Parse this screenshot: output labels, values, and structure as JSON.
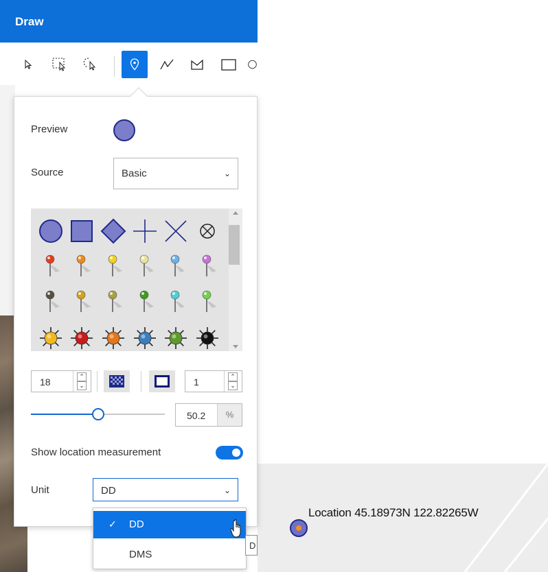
{
  "header": {
    "title": "Draw"
  },
  "toolbar": {
    "tools": [
      {
        "name": "select-tool",
        "label": "Select"
      },
      {
        "name": "rectangle-select-tool",
        "label": "Rectangle select"
      },
      {
        "name": "lasso-select-tool",
        "label": "Lasso select"
      },
      {
        "name": "point-tool",
        "label": "Point",
        "active": true
      },
      {
        "name": "polyline-tool",
        "label": "Polyline"
      },
      {
        "name": "polygon-tool",
        "label": "Polygon"
      },
      {
        "name": "rectangle-tool",
        "label": "Rectangle"
      },
      {
        "name": "circle-tool",
        "label": "Circle"
      }
    ]
  },
  "symbol_panel": {
    "preview_label": "Preview",
    "source_label": "Source",
    "source_value": "Basic",
    "gallery": {
      "rows": [
        [
          "circle",
          "square",
          "diamond",
          "cross",
          "x",
          "circle-x"
        ],
        [
          "pin-red",
          "pin-orange",
          "pin-yellow",
          "pin-light-yellow",
          "pin-light-blue",
          "pin-purple"
        ],
        [
          "pin-dark",
          "pin-gold",
          "pin-olive",
          "pin-green",
          "pin-cyan",
          "pin-light-green"
        ],
        [
          "star-yellow",
          "star-red",
          "star-orange",
          "star-blue",
          "star-green",
          "star-black"
        ]
      ],
      "colors": {
        "basic_fill": "#7c7ec9",
        "basic_stroke": "#1f2a8a",
        "pins": [
          "#e53c1c",
          "#f08a1c",
          "#f2d21e",
          "#e8e3a0",
          "#6fb1e6",
          "#c572d8",
          "#565040",
          "#d6a11a",
          "#a7a13d",
          "#3f9a1d",
          "#4cd0d6",
          "#72d24a"
        ],
        "stars": [
          "#f2b81c",
          "#c91b1b",
          "#e6761c",
          "#3a7fbd",
          "#5f9a2c",
          "#111111"
        ]
      }
    },
    "size_value": "18",
    "outline_width_value": "1",
    "opacity_value": "50.2",
    "opacity_unit": "%",
    "opacity_fraction": 0.502,
    "show_measurement_label": "Show location measurement",
    "show_measurement_on": true,
    "unit_label": "Unit",
    "unit_value": "DD",
    "unit_options": [
      "DD",
      "DMS"
    ],
    "unit_selected_check": "✓",
    "tooltip_text": "D"
  },
  "map": {
    "location_label": "Location 45.18973N 122.82265W",
    "marker_fill": "#6f71c6",
    "marker_stroke": "#232a86",
    "marker_center": "#f09020"
  },
  "colors": {
    "accent": "#0d74e5",
    "header": "#0d6fd8"
  }
}
